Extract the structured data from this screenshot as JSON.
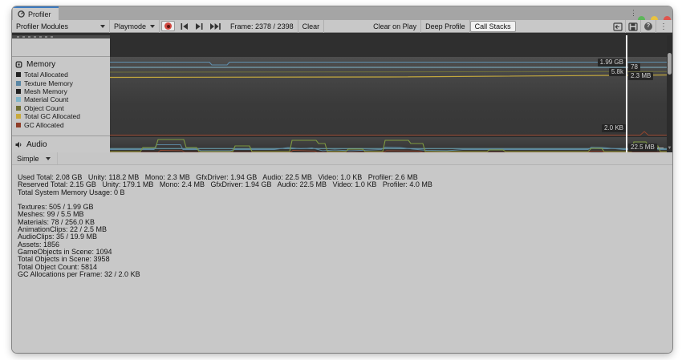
{
  "window": {
    "tab_title": "Profiler",
    "traffic_lights": {
      "green": "#5db65a",
      "yellow": "#e9c341",
      "red": "#e0554d"
    },
    "strip_menu_icon": "⋮"
  },
  "toolbar": {
    "profiler_modules_label": "Profiler Modules",
    "playmode_label": "Playmode",
    "frame_label": "Frame: 2378 / 2398",
    "clear_label": "Clear",
    "clear_on_play_label": "Clear on Play",
    "deep_profile_label": "Deep Profile",
    "call_stacks_label": "Call Stacks",
    "help_glyph": "?",
    "kebab_glyph": "⋮"
  },
  "sidebar": {
    "modules": [
      {
        "name": "Memory",
        "legend": [
          {
            "label": "Total Allocated",
            "color": "#222222"
          },
          {
            "label": "Texture Memory",
            "color": "#5a87a5"
          },
          {
            "label": "Mesh Memory",
            "color": "#222222"
          },
          {
            "label": "Material Count",
            "color": "#7fb6ca"
          },
          {
            "label": "Object Count",
            "color": "#6e6e33"
          },
          {
            "label": "Total GC Allocated",
            "color": "#c9aa3c"
          },
          {
            "label": "GC Allocated",
            "color": "#8f3d28"
          }
        ]
      },
      {
        "name": "Audio"
      }
    ]
  },
  "chart": {
    "line_colors": {
      "texture_memory": "#5f8fae",
      "material_count": "#82b8cc",
      "object_count": "#70703a",
      "total_gc_allocated": "#c3a83e",
      "gc_allocated": "#96462e",
      "audio_green": "#7f9b40",
      "audio_blue": "#5b87a0",
      "audio_cyan": "#6fa8b8",
      "audio_red": "#96462e"
    },
    "selected_frame_values": [
      {
        "series": "Texture Memory",
        "text": "1.99 GB"
      },
      {
        "series": "Material Count",
        "text": "78"
      },
      {
        "series": "Object Count",
        "text": "5.8k"
      },
      {
        "series": "Total GC Allocated",
        "text": "2.3 MB"
      },
      {
        "series": "GC Allocated",
        "text": "2.0 KB"
      },
      {
        "series": "Audio",
        "text": "22.5 MB"
      }
    ],
    "scroll_down_glyph": "▼"
  },
  "details": {
    "mode_label": "Simple",
    "summary_lines": [
      "Used Total: 2.08 GB   Unity: 118.2 MB   Mono: 2.3 MB   GfxDriver: 1.94 GB   Audio: 22.5 MB   Video: 1.0 KB   Profiler: 2.6 MB",
      "Reserved Total: 2.15 GB   Unity: 179.1 MB   Mono: 2.4 MB   GfxDriver: 1.94 GB   Audio: 22.5 MB   Video: 1.0 KB   Profiler: 4.0 MB",
      "Total System Memory Usage: 0 B"
    ],
    "object_lines": [
      "Textures: 505 / 1.99 GB",
      "Meshes: 99 / 5.5 MB",
      "Materials: 78 / 256.0 KB",
      "AnimationClips: 22 / 2.5 MB",
      "AudioClips: 35 / 19.9 MB",
      "Assets: 1856",
      "GameObjects in Scene: 1094",
      "Total Objects in Scene: 3958",
      "Total Object Count: 5814",
      "GC Allocations per Frame: 32 / 2.0 KB"
    ]
  }
}
